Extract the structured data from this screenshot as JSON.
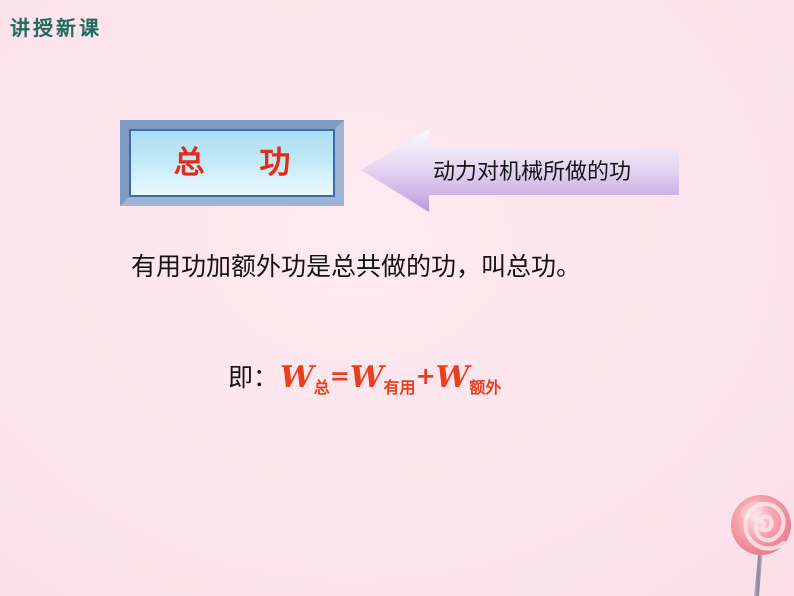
{
  "slide": {
    "background_color": "#fde7ee",
    "section_heading": "讲授新课",
    "section_heading_color": "#1f6b5e"
  },
  "title_box": {
    "label": "总  功",
    "text_color": "#e32b17",
    "fill_top_color": "#a9ddf2",
    "fill_bottom_color": "#e9f8fd",
    "border_color": "#3d6aa8"
  },
  "arrow_callout": {
    "label": "动力对机械所做的功",
    "direction": "left",
    "fill_top_color": "#f7f2fb",
    "fill_bottom_color": "#b79ad8",
    "text_color": "#141414"
  },
  "body": {
    "sentence": "有用功加额外功是总共做的功，叫总功。",
    "text_color": "#141414"
  },
  "formula": {
    "prefix": "即：",
    "prefix_color": "#141414",
    "expression_color": "#e8401f",
    "terms": [
      {
        "symbol": "W",
        "subscript": "总"
      },
      {
        "symbol": "W",
        "subscript": "有用"
      },
      {
        "symbol": "W",
        "subscript": "额外"
      }
    ],
    "operators": [
      "=",
      "+"
    ],
    "plain_text": "W总=W有用+W额外"
  },
  "decoration": {
    "lollipop_label": "lollipop",
    "candy_color": "#f08a95",
    "candy_highlight_color": "#fbd9dd",
    "stick_color": "#9a93a0"
  }
}
